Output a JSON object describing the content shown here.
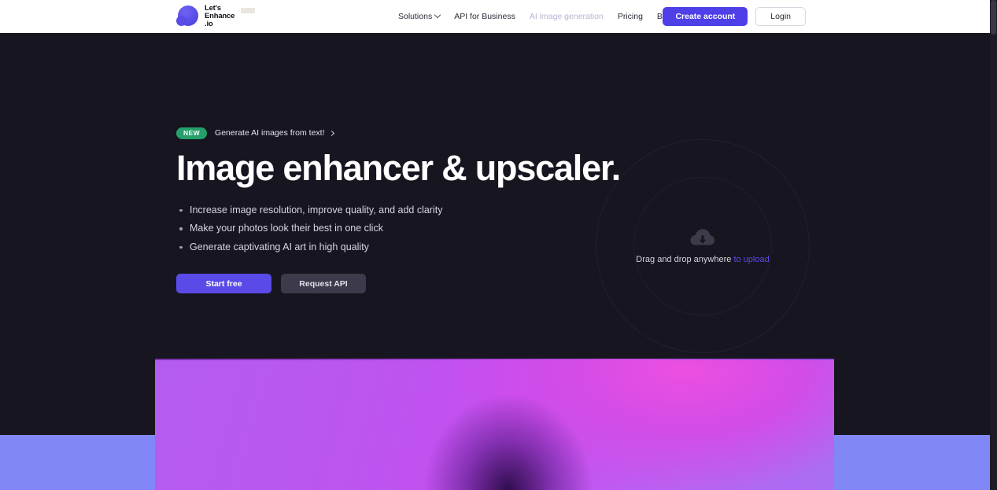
{
  "header": {
    "logo": {
      "line1": "Let's",
      "line2": "Enhance",
      "line3": ".io",
      "mark_icon": "lets-enhance-blob-logo"
    },
    "nav": [
      {
        "label": "Solutions",
        "has_dropdown": true,
        "muted": false
      },
      {
        "label": "API for Business",
        "has_dropdown": false,
        "muted": false
      },
      {
        "label": "AI image generation",
        "has_dropdown": false,
        "muted": true
      },
      {
        "label": "Pricing",
        "has_dropdown": false,
        "muted": false
      },
      {
        "label": "Blog",
        "has_dropdown": false,
        "muted": false
      }
    ],
    "create_account_label": "Create account",
    "login_label": "Login"
  },
  "hero": {
    "badge": "NEW",
    "badge_link": "Generate AI images from text!",
    "title": "Image enhancer & upscaler.",
    "bullets": [
      "Increase image resolution, improve quality, and add clarity",
      "Make your photos look their best in one click",
      "Generate captivating AI art in high quality"
    ],
    "primary_cta": "Start free",
    "secondary_cta": "Request API"
  },
  "dropzone": {
    "icon": "cloud-upload-icon",
    "text": "Drag and drop anywhere",
    "link_text": "to upload"
  },
  "colors": {
    "page_background": "#17151f",
    "header_background": "#ffffff",
    "accent_purple": "#4e3fe8",
    "cta_purple": "#5a4ae8",
    "secondary_button": "#3d3b4b",
    "badge_green": "#24a06a",
    "upload_link": "#5b4ce6",
    "bottom_band": "#8287f8",
    "nav_muted": "#b7b4d0"
  }
}
